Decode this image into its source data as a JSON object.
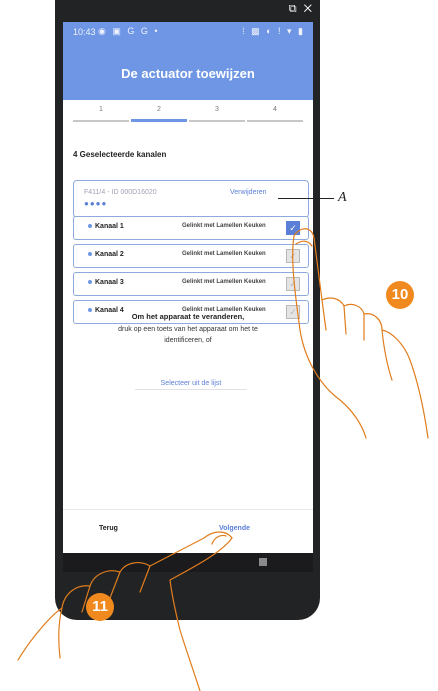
{
  "window_icons": "⧉ ✕",
  "status_bar": {
    "time": "10:43",
    "left_icons": "◉ ▣ G G •",
    "right_icons": "⁞ ▩ ◐ ! ▾ ▮"
  },
  "app_bar": {
    "title": "De actuator toewijzen"
  },
  "stepper": {
    "steps": [
      "1",
      "2",
      "3",
      "4"
    ],
    "active_step": 2
  },
  "section_title": "4 Geselecteerde kanalen",
  "device": {
    "id_text": "F411/4 - ID 000D16020",
    "dots": "●●●●",
    "remove_label": "Verwijderen"
  },
  "channels": [
    {
      "name": "Kanaal 1",
      "linked": "Gelinkt met Lamellen Keuken",
      "checked": true
    },
    {
      "name": "Kanaal 2",
      "linked": "Gelinkt met Lamellen Keuken",
      "checked": false
    },
    {
      "name": "Kanaal 3",
      "linked": "Gelinkt met Lamellen Keuken",
      "checked": false
    },
    {
      "name": "Kanaal 4",
      "linked": "Gelinkt met Lamellen Keuken",
      "checked": false
    }
  ],
  "change_device": {
    "title": "Om het apparaat te veranderen,",
    "line1": "druk op een toets van het apparaat om het te",
    "line2": "identificeren, of",
    "select_label": "Selecteer uit de lijst"
  },
  "bottom": {
    "back_label": "Terug",
    "next_label": "Volgende"
  },
  "annotation": {
    "marker": "A",
    "step_a": "10",
    "step_b": "11"
  },
  "colors": {
    "primary": "#6f96e4",
    "link": "#5b7fd6",
    "badge": "#f08a1e"
  }
}
